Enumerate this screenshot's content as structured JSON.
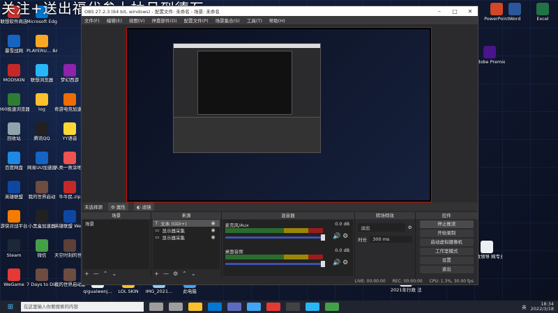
{
  "overlay": {
    "text": "关注+送出福代参上抽月到德石"
  },
  "desktop": {
    "icons_left": [
      {
        "label": "联想软件商店",
        "icon": "store-icon",
        "color": "#d0342c"
      },
      {
        "label": "暴雪战网",
        "icon": "battlenet-icon",
        "color": "#1565c0"
      },
      {
        "label": "MODSKIN",
        "icon": "modskin-icon",
        "color": "#c62828"
      },
      {
        "label": "360极速浏览器",
        "icon": "browser-icon",
        "color": "#2e7d32"
      },
      {
        "label": "回收站",
        "icon": "recycle-bin-icon",
        "color": "#90a4ae"
      },
      {
        "label": "百度网盘",
        "icon": "cloud-icon",
        "color": "#1e88e5"
      },
      {
        "label": "英雄联盟",
        "icon": "lol-icon",
        "color": "#0d47a1"
      },
      {
        "label": "游侠对战平台",
        "icon": "game-icon",
        "color": "#f57c00"
      },
      {
        "label": "Steam",
        "icon": "steam-icon",
        "color": "#1b2838"
      },
      {
        "label": "WeGame",
        "icon": "wegame-icon",
        "color": "#e53935"
      }
    ],
    "icons_col2": [
      {
        "label": "Microsoft Edge",
        "icon": "edge-icon",
        "color": "#0078d4"
      },
      {
        "label": "PLAYERU... BATTLEGR...",
        "icon": "pubg-icon",
        "color": "#f9a825"
      },
      {
        "label": "联想浏览器",
        "icon": "lenovo-browser-icon",
        "color": "#29b6f6"
      },
      {
        "label": "log",
        "icon": "folder-icon",
        "color": "#fbc02d"
      },
      {
        "label": "腾讯QQ",
        "icon": "qq-icon",
        "color": "#212121"
      },
      {
        "label": "网易UU加速器",
        "icon": "uu-icon",
        "color": "#1565c0"
      },
      {
        "label": "我的世界启动",
        "icon": "minecraft-icon",
        "color": "#6d4c41"
      },
      {
        "label": "小黑盒加速器",
        "icon": "xiaoheihe-icon",
        "color": "#212121"
      },
      {
        "label": "微信",
        "icon": "wechat-icon",
        "color": "#43a047"
      },
      {
        "label": "7 Days to Die",
        "icon": "7dtd-icon",
        "color": "#6d4c41"
      }
    ],
    "icons_col3": [
      {
        "label": "梦幻西游",
        "icon": "game-icon",
        "color": "#8e24aa"
      },
      {
        "label": "奇游电竞加速器",
        "icon": "accelerator-icon",
        "color": "#ef6c00"
      },
      {
        "label": "YY语音",
        "icon": "yy-icon",
        "color": "#fdd835"
      },
      {
        "label": "人类一败涂地 Human Fa...",
        "icon": "human-fall-flat-icon",
        "color": "#ef5350"
      },
      {
        "label": "牛牛民.zip",
        "icon": "zip-icon",
        "color": "#c62828"
      },
      {
        "label": "英雄联盟 WeGame版",
        "icon": "lol-wegame-icon",
        "color": "#0d47a1"
      },
      {
        "label": "天空时刻的世界 1.15.2的",
        "icon": "game-icon",
        "color": "#5d4037"
      },
      {
        "label": "我的世界启动器",
        "icon": "minecraft-icon",
        "color": "#6d4c41"
      }
    ],
    "icons_right": [
      {
        "label": "PowerPoint",
        "icon": "powerpoint-icon",
        "color": "#d24726"
      },
      {
        "label": "Word",
        "icon": "word-icon",
        "color": "#2b579a"
      },
      {
        "label": "Excel",
        "icon": "excel-icon",
        "color": "#217346"
      },
      {
        "label": "Adobe Premiere ...",
        "icon": "premiere-icon",
        "color": "#4a148c"
      },
      {
        "label": "行政领导 网专业...",
        "icon": "document-icon",
        "color": "#eceff1"
      },
      {
        "label": "2021年行政 法与行政执...",
        "icon": "document-icon",
        "color": "#eceff1"
      }
    ],
    "icons_bottom": [
      {
        "label": "qiguaiwenj...",
        "icon": "file-icon",
        "color": "#eceff1"
      },
      {
        "label": "LOL SKIN",
        "icon": "folder-icon",
        "color": "#fbc02d"
      },
      {
        "label": "IMG_2021...",
        "icon": "image-icon",
        "color": "#90caf9"
      },
      {
        "label": "此电脑",
        "icon": "this-pc-icon",
        "color": "#42a5f5"
      }
    ]
  },
  "obs": {
    "title": "OBS 27.2.3 (64 bit, windows) - 配置文件: 未命名 - 场景: 未命名",
    "menu": [
      "文件(F)",
      "编辑(E)",
      "视图(V)",
      "停靠部件(D)",
      "配置文件(P)",
      "场景集合(S)",
      "工具(T)",
      "帮助(H)"
    ],
    "scene_bar": {
      "label": "未选择源",
      "props": "属性",
      "filters": "滤镜"
    },
    "docks": {
      "scenes": {
        "title": "场景",
        "items": [
          "场景"
        ]
      },
      "sources": {
        "title": "来源",
        "items": [
          "文本 (GDI+)",
          "显示器采集",
          "显示器采集"
        ]
      },
      "mixer": {
        "title": "混音器",
        "channels": [
          {
            "name": "麦克风/Aux",
            "db": "0.0 dB"
          },
          {
            "name": "桌面音频",
            "db": "0.0 dB"
          }
        ]
      },
      "transitions": {
        "title": "转场特效",
        "type": "淡出",
        "duration_label": "时长",
        "duration": "300 ms"
      },
      "controls": {
        "title": "控件",
        "buttons": [
          "停止推流",
          "开始录制",
          "启动虚拟摄像机",
          "工作室模式",
          "设置",
          "退出"
        ]
      }
    },
    "status": {
      "live": "LIVE: 00:00:00",
      "rec": "REC: 00:00:00",
      "cpu": "CPU: 1.3%, 30.00 fps"
    }
  },
  "taskbar": {
    "search_placeholder": "在这里输入你要搜索的内容",
    "apps": [
      {
        "icon": "cortana-icon",
        "color": "#9e9e9e"
      },
      {
        "icon": "task-view-icon",
        "color": "#9e9e9e"
      },
      {
        "icon": "file-explorer-icon",
        "color": "#fbc02d"
      },
      {
        "icon": "edge-icon",
        "color": "#0078d4"
      },
      {
        "icon": "store-icon",
        "color": "#5c6bc0"
      },
      {
        "icon": "mail-icon",
        "color": "#42a5f5"
      },
      {
        "icon": "lenovo-icon",
        "color": "#e53935"
      },
      {
        "icon": "obs-icon",
        "color": "#424242"
      },
      {
        "icon": "qq-icon",
        "color": "#29b6f6"
      },
      {
        "icon": "wechat-icon",
        "color": "#43a047"
      }
    ],
    "tray": {
      "lang": "英",
      "time": "18:34",
      "date": "2022/3/18"
    }
  }
}
